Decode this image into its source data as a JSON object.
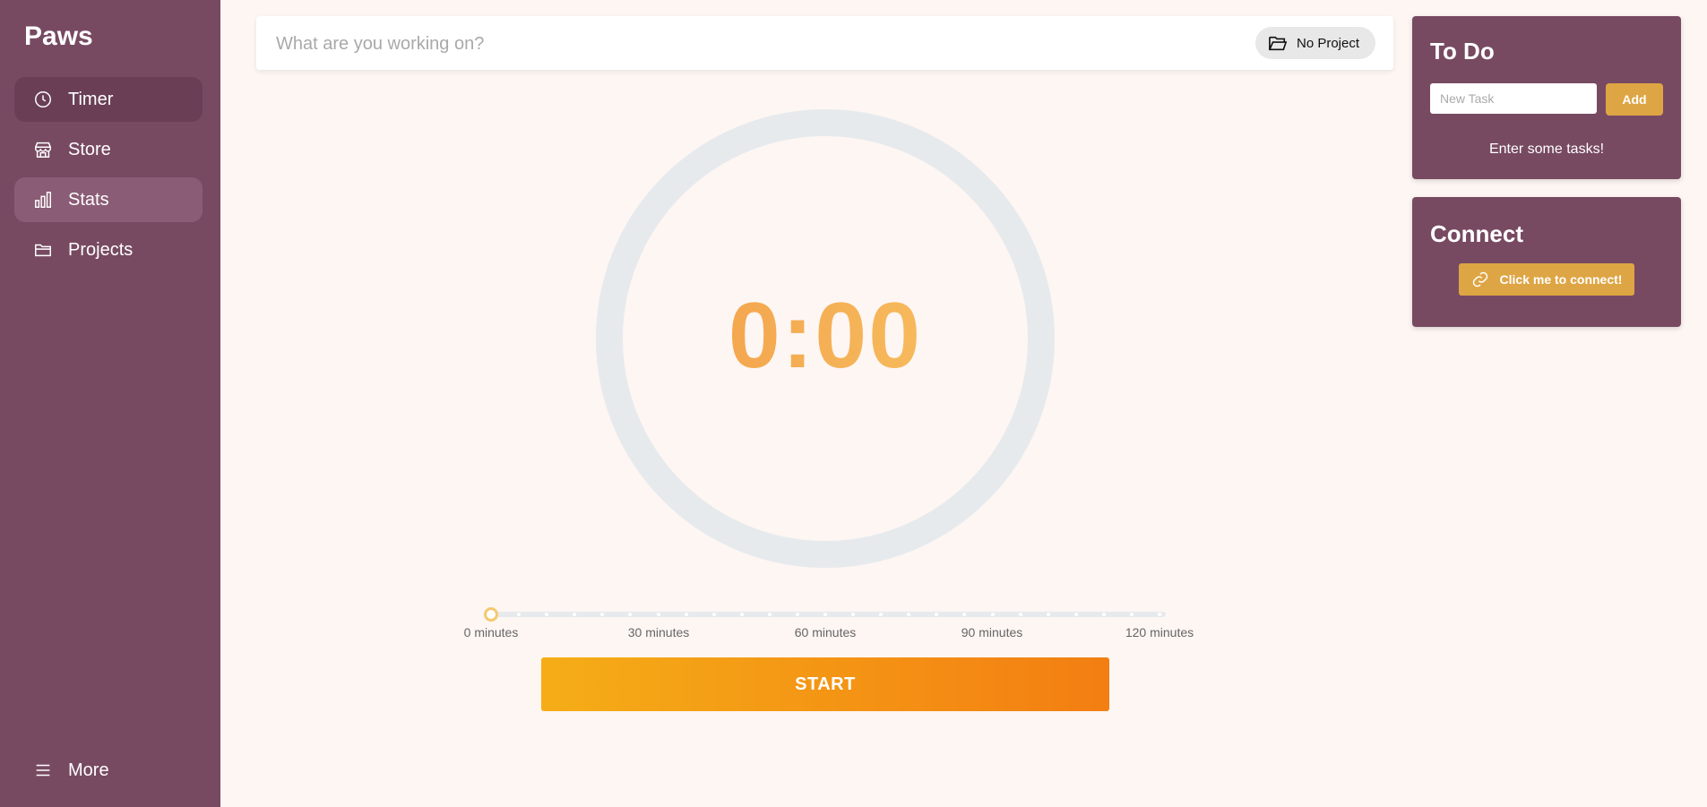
{
  "sidebar": {
    "brand": "Paws",
    "items": [
      {
        "label": "Timer",
        "icon": "clock-icon"
      },
      {
        "label": "Store",
        "icon": "store-icon"
      },
      {
        "label": "Stats",
        "icon": "bar-chart-icon"
      },
      {
        "label": "Projects",
        "icon": "folder-icon"
      }
    ],
    "more_label": "More"
  },
  "task": {
    "placeholder": "What are you working on?",
    "project_label": "No Project"
  },
  "timer": {
    "display": "0:00",
    "slider": {
      "value_minutes": 0,
      "min_minutes": 0,
      "max_minutes": 120,
      "labels": [
        "0 minutes",
        "30 minutes",
        "60 minutes",
        "90 minutes",
        "120 minutes"
      ]
    },
    "start_label": "START"
  },
  "todo": {
    "title": "To Do",
    "input_placeholder": "New Task",
    "add_label": "Add",
    "empty_text": "Enter some tasks!"
  },
  "connect": {
    "title": "Connect",
    "button_label": "Click me to connect!"
  },
  "colors": {
    "sidebar": "#774a62",
    "accent_gold": "#dea544",
    "start_gradient_start": "#f5ad17",
    "start_gradient_end": "#f37e12",
    "background": "#fdf6f3"
  }
}
